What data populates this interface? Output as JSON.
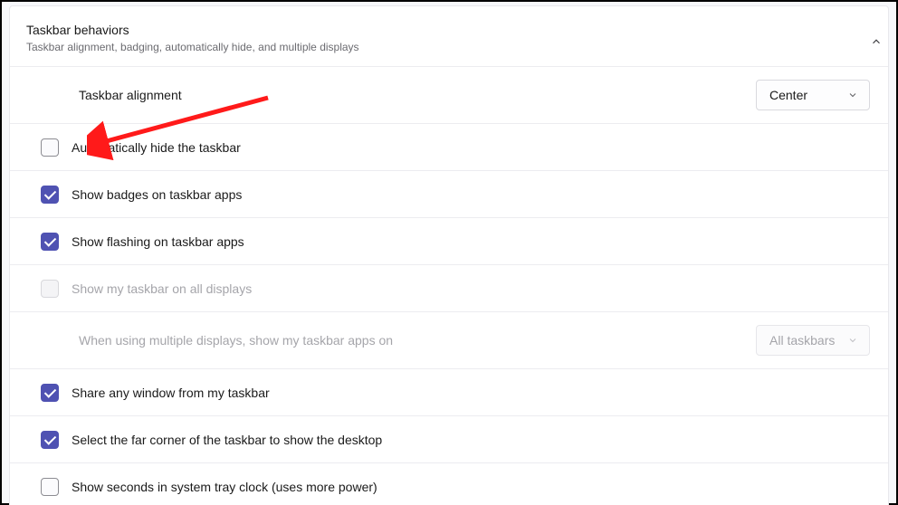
{
  "section": {
    "title": "Taskbar behaviors",
    "subtitle": "Taskbar alignment, badging, automatically hide, and multiple displays"
  },
  "alignment": {
    "label": "Taskbar alignment",
    "selected": "Center"
  },
  "items": [
    {
      "label": "Automatically hide the taskbar",
      "checked": false,
      "disabled": false
    },
    {
      "label": "Show badges on taskbar apps",
      "checked": true,
      "disabled": false
    },
    {
      "label": "Show flashing on taskbar apps",
      "checked": true,
      "disabled": false
    },
    {
      "label": "Show my taskbar on all displays",
      "checked": false,
      "disabled": true
    }
  ],
  "multi": {
    "label": "When using multiple displays, show my taskbar apps on",
    "selected": "All taskbars",
    "disabled": true
  },
  "items2": [
    {
      "label": "Share any window from my taskbar",
      "checked": true,
      "disabled": false
    },
    {
      "label": "Select the far corner of the taskbar to show the desktop",
      "checked": true,
      "disabled": false
    },
    {
      "label": "Show seconds in system tray clock (uses more power)",
      "checked": false,
      "disabled": false
    }
  ],
  "colors": {
    "accent": "#4f52b2",
    "arrow": "#ff1a1a"
  }
}
